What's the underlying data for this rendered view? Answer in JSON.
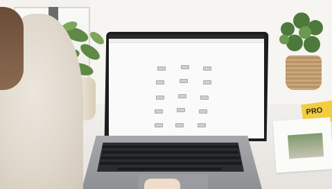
{
  "scene": {
    "description_tags": [
      "laptop",
      "plants",
      "desk"
    ],
    "magazine_text": "PRO"
  },
  "screen": {
    "tabs": [],
    "page_title": "",
    "devices": [
      {
        "label": ""
      },
      {
        "label": ""
      },
      {
        "label": ""
      },
      {
        "label": ""
      },
      {
        "label": ""
      },
      {
        "label": ""
      },
      {
        "label": ""
      },
      {
        "label": ""
      },
      {
        "label": ""
      },
      {
        "label": ""
      },
      {
        "label": ""
      },
      {
        "label": ""
      },
      {
        "label": ""
      },
      {
        "label": ""
      },
      {
        "label": ""
      }
    ]
  }
}
